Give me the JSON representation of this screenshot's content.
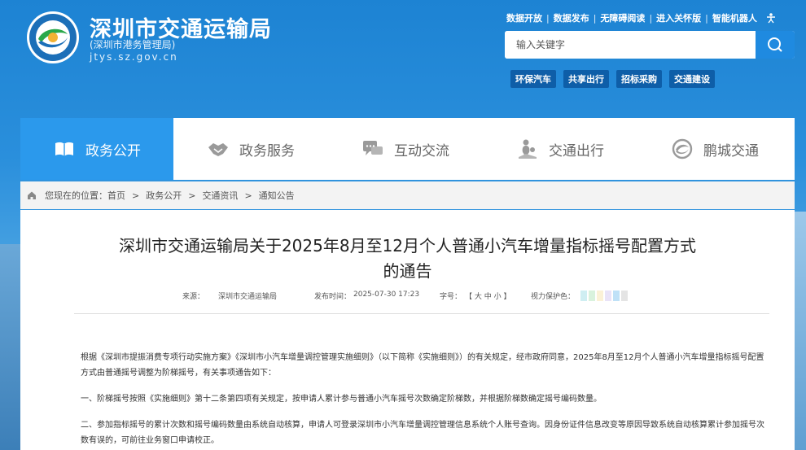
{
  "site": {
    "title": "深圳市交通运输局",
    "subtitle": "(深圳市港务管理局)",
    "domain": "jtys.sz.gov.cn"
  },
  "toplinks": [
    "数据开放",
    "数据发布",
    "无障碍阅读",
    "进入关怀版",
    "智能机器人"
  ],
  "search": {
    "placeholder": "输入关键字"
  },
  "tags": [
    "环保汽车",
    "共享出行",
    "招标采购",
    "交通建设"
  ],
  "nav": [
    {
      "label": "政务公开",
      "icon": "book-icon"
    },
    {
      "label": "政务服务",
      "icon": "handshake-icon"
    },
    {
      "label": "互动交流",
      "icon": "chat-icon"
    },
    {
      "label": "交通出行",
      "icon": "map-person-icon"
    },
    {
      "label": "鹏城交通",
      "icon": "logo-swirl-icon"
    }
  ],
  "breadcrumb": {
    "prefix": "您现在的位置：",
    "items": [
      "首页",
      "政务公开",
      "交通资讯",
      "通知公告"
    ]
  },
  "article": {
    "title_line1": "深圳市交通运输局关于2025年8月至12月个人普通小汽车增量指标摇号配置方式",
    "title_line2": "的通告",
    "meta": {
      "source_label": "来源：",
      "source": "深圳市交通运输局",
      "date_label": "发布时间：",
      "date": "2025-07-30 17:23",
      "font_label": "字号：",
      "font_sizes": "【 大 中 小 】",
      "eye_label": "视力保护色："
    },
    "eye_colors": [
      "#cfeef2",
      "#d9f2dd",
      "#fbf1d6",
      "#e9e3f7",
      "#bfe1f7",
      "#e4e4e4"
    ],
    "paragraphs": [
      "根据《深圳市提振消费专项行动实施方案》《深圳市小汽车增量调控管理实施细则》（以下简称《实施细则》）的有关规定，经市政府同意，2025年8月至12月个人普通小汽车增量指标摇号配置方式由普通摇号调整为阶梯摇号，有关事项通告如下：",
      "一、阶梯摇号按照《实施细则》第十二条第四项有关规定，按申请人累计参与普通小汽车摇号次数确定阶梯数，并根据阶梯数确定摇号编码数量。",
      "二、参加指标摇号的累计次数和摇号编码数量由系统自动核算，申请人可登录深圳市小汽车增量调控管理信息系统个人账号查询。因身份证件信息改变等原因导致系统自动核算累计参加摇号次数有误的，可前往业务窗口申请校正。"
    ]
  }
}
